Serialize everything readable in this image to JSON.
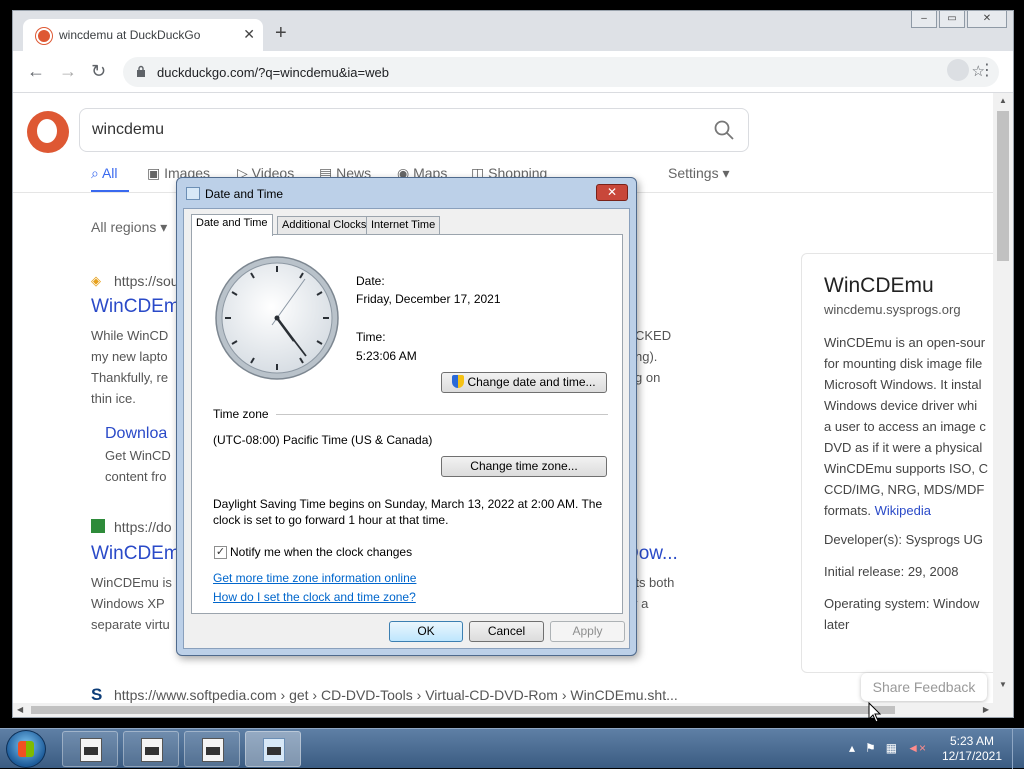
{
  "browser": {
    "tab_title": "wincdemu at DuckDuckGo",
    "tab_close": "✕",
    "new_tab": "+",
    "url": "duckduckgo.com/?q=wincdemu&ia=web",
    "window_buttons": {
      "minimize": "–",
      "maximize": "▭",
      "close": "✕"
    }
  },
  "search": {
    "query": "wincdemu",
    "filters": {
      "all": "All",
      "images": "Images",
      "videos": "Videos",
      "news": "News",
      "maps": "Maps",
      "shopping": "Shopping",
      "settings": "Settings ▾"
    },
    "regions": "All regions ▾"
  },
  "results": [
    {
      "url": "https://sou",
      "title": "WinCDEmu",
      "snippet": [
        "While WinCD",
        "my new lapto",
        "Thankfully, re",
        "thin ice."
      ],
      "snippet_right": [
        "CKED",
        "ng).",
        "g on"
      ],
      "sublink_title": "Downloa",
      "sublink_snippet": [
        "Get WinCD",
        "content fro"
      ]
    },
    {
      "url": "https://do",
      "title": "WinCDEmu",
      "title_right": "Dow...",
      "snippet": [
        "WinCDEmu is",
        "Windows XP",
        "separate virtu"
      ],
      "snippet_right": [
        "rts both",
        "y a"
      ]
    },
    {
      "url": "https://www.softpedia.com › get › CD-DVD-Tools › Virtual-CD-DVD-Rom › WinCDEmu.sht..."
    }
  ],
  "knowledge_panel": {
    "title": "WinCDEmu",
    "domain": "wincdemu.sysprogs.org",
    "description": "WinCDEmu is an open-sour\nfor mounting disk image file\nMicrosoft Windows. It instal\nWindows device driver whi\na user to access an image c\nDVD as if it were a physical\nWinCDEmu supports ISO, C\nCCD/IMG, NRG, MDS/MDF\nformats.",
    "wikipedia": "Wikipedia",
    "developer": "Developer(s):  Sysprogs UG",
    "release": "Initial release:  29, 2008",
    "os": "Operating system:  Window",
    "os_cont": "later"
  },
  "feedback": "Share Feedback",
  "dialog": {
    "title": "Date and Time",
    "close": "✕",
    "tabs": [
      "Date and Time",
      "Additional Clocks",
      "Internet Time"
    ],
    "date_label": "Date:",
    "date_value": "Friday, December 17, 2021",
    "time_label": "Time:",
    "time_value": "5:23:06 AM",
    "change_datetime": "Change date and time...",
    "timezone_header": "Time zone",
    "timezone_value": "(UTC-08:00) Pacific Time (US & Canada)",
    "change_timezone": "Change time zone...",
    "dst_line1": "Daylight Saving Time begins on Sunday, March 13, 2022 at 2:00 AM. The",
    "dst_line2": "clock is set to go forward 1 hour at that time.",
    "notify_label": "Notify me when the clock changes",
    "notify_checked": "✓",
    "link1": "Get more time zone information online",
    "link2": "How do I set the clock and time zone?",
    "ok": "OK",
    "cancel": "Cancel",
    "apply": "Apply"
  },
  "taskbar": {
    "time": "5:23 AM",
    "date": "12/17/2021"
  }
}
